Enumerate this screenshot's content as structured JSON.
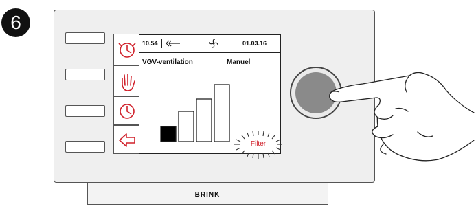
{
  "step": {
    "number": "6"
  },
  "statusbar": {
    "time": "10.54",
    "date": "01.03.16"
  },
  "main": {
    "mode_title": "VGV-ventilation",
    "mode_value": "Manuel"
  },
  "alert": {
    "label": "Filter"
  },
  "brand": {
    "name": "BRINK"
  },
  "icons": {
    "menu_keys": [
      "clock-alert-icon",
      "hand-icon",
      "clock-icon",
      "back-arrow-icon"
    ],
    "status": [
      "input-arrow-icon",
      "fan-icon"
    ]
  },
  "fan_level": {
    "current": 1,
    "max": 4
  },
  "colors": {
    "accent": "#d0202a",
    "alert": "#d0202a",
    "knob": "#8a8a8a"
  }
}
